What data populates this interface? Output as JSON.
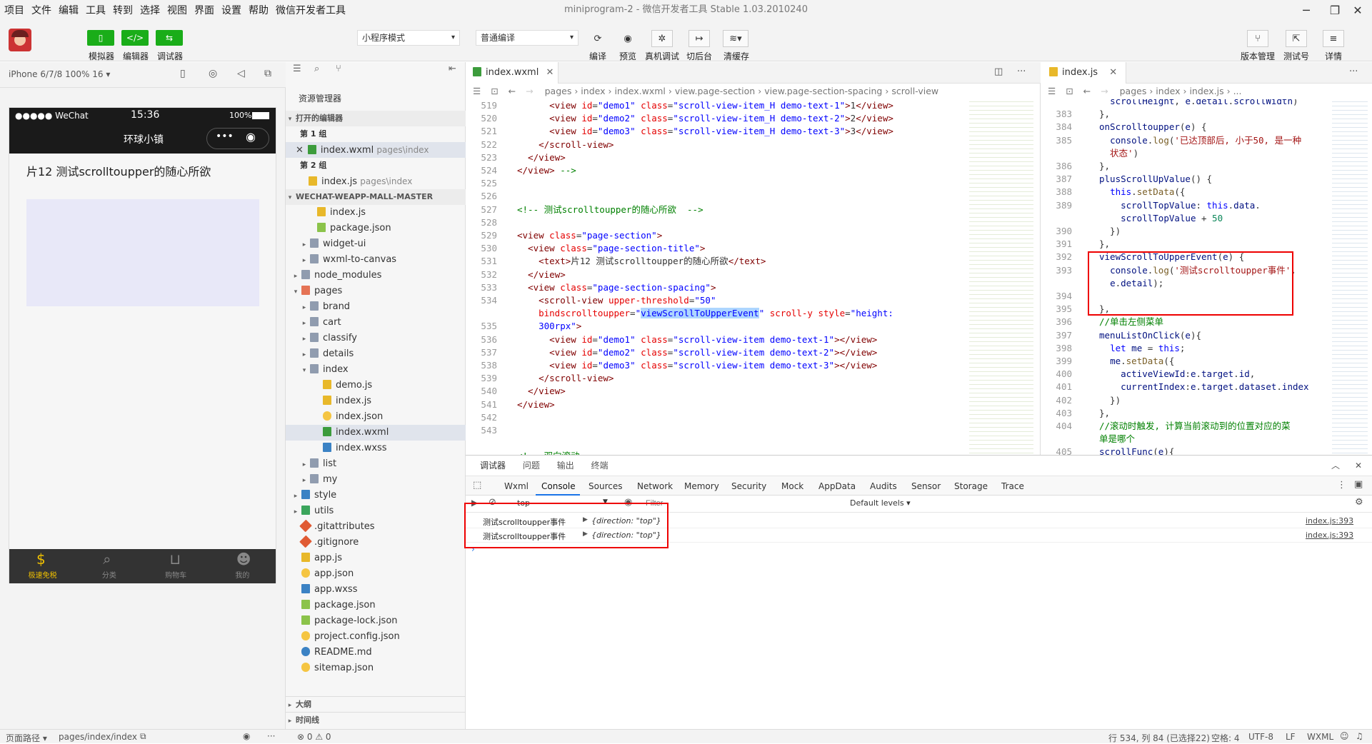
{
  "app": {
    "menu": [
      "项目",
      "文件",
      "编辑",
      "工具",
      "转到",
      "选择",
      "视图",
      "界面",
      "设置",
      "帮助",
      "微信开发者工具"
    ],
    "window_title": "miniprogram-2 - 微信开发者工具 Stable 1.03.2010240"
  },
  "toolbar": {
    "simulator_label": "模拟器",
    "editor_label": "编辑器",
    "debugger_label": "调试器",
    "mode_select": "小程序模式",
    "compile_select": "普通编译",
    "compile_label": "编译",
    "preview_label": "预览",
    "remote_debug_label": "真机调试",
    "background_label": "切后台",
    "clear_cache_label": "清缓存",
    "version_label": "版本管理",
    "test_label": "测试号",
    "details_label": "详情"
  },
  "simulator": {
    "device": "iPhone 6/7/8 100% 16 ▾",
    "carrier": "●●●●● WeChat",
    "time": "15:36",
    "battery": "100%",
    "nav_title": "环球小镇",
    "page_text": "片12 测试scrolltoupper的随心所欲",
    "tabs": [
      "极速免税",
      "分类",
      "购物车",
      "我的"
    ],
    "accent": "#f0c000"
  },
  "explorer": {
    "header": "资源管理器",
    "open_editors": "打开的编辑器",
    "group1": "第 1 组",
    "open_file1": "index.wxml",
    "open_file1_path": "pages\\index",
    "group2": "第 2 组",
    "open_file2": "index.js",
    "open_file2_path": "pages\\index",
    "project": "WECHAT-WEAPP-MALL-MASTER",
    "items": [
      "index.js",
      "package.json",
      "widget-ui",
      "wxml-to-canvas",
      "node_modules",
      "pages",
      "brand",
      "cart",
      "classify",
      "details",
      "index",
      "demo.js",
      "index.js",
      "index.json",
      "index.wxml",
      "index.wxss",
      "list",
      "my",
      "style",
      "utils",
      ".gitattributes",
      ".gitignore",
      "app.js",
      "app.json",
      "app.wxss",
      "package.json",
      "package-lock.json",
      "project.config.json",
      "README.md",
      "sitemap.json"
    ],
    "outline": "大纲",
    "timeline": "时间线"
  },
  "editor": {
    "tab": "index.wxml",
    "breadcrumb": [
      "pages",
      "index",
      "index.wxml",
      "view.page-section",
      "view.page-section-spacing",
      "scroll-view"
    ]
  },
  "editor2": {
    "tab": "index.js",
    "breadcrumb": [
      "pages",
      "index",
      "index.js",
      "..."
    ]
  },
  "devtools": {
    "top_tabs": [
      "调试器",
      "问题",
      "输出",
      "终端"
    ],
    "tabs": [
      "Wxml",
      "Console",
      "Sources",
      "Network",
      "Memory",
      "Security",
      "Mock",
      "AppData",
      "Audits",
      "Sensor",
      "Storage",
      "Trace"
    ],
    "context": "top",
    "filter_placeholder": "Filter",
    "levels": "Default levels ▾",
    "logs": [
      {
        "msg": "测试scrolltoupper事件",
        "obj": "{direction: \"top\"}",
        "src": "index.js:393"
      },
      {
        "msg": "测试scrolltoupper事件",
        "obj": "{direction: \"top\"}",
        "src": "index.js:393"
      }
    ]
  },
  "status": {
    "left_path_label": "页面路径 ▾",
    "page_path": "pages/index/index",
    "problems": "⊗ 0 ⚠ 0",
    "cursor": "行 534, 列 84 (已选择22)",
    "indent": "空格: 4",
    "encoding": "UTF-8",
    "eol": "LF",
    "lang": "WXML"
  }
}
